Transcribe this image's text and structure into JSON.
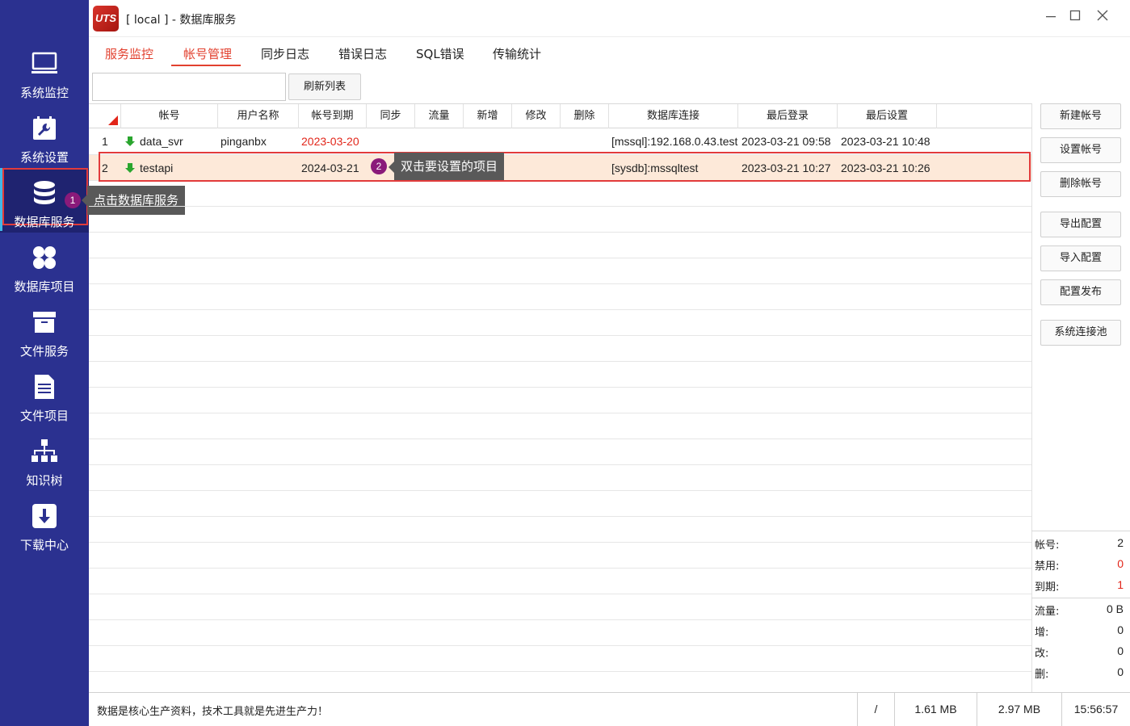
{
  "window": {
    "title": "[ local ] - 数据库服务",
    "logo_text": "UTS"
  },
  "sidebar": {
    "items": [
      {
        "label": "系统监控",
        "icon": "monitor-icon"
      },
      {
        "label": "系统设置",
        "icon": "settings-wrench-icon"
      },
      {
        "label": "数据库服务",
        "icon": "database-icon",
        "active": true
      },
      {
        "label": "数据库项目",
        "icon": "grid-dots-icon"
      },
      {
        "label": "文件服务",
        "icon": "archive-box-icon"
      },
      {
        "label": "文件项目",
        "icon": "document-list-icon"
      },
      {
        "label": "知识树",
        "icon": "org-tree-icon"
      },
      {
        "label": "下载中心",
        "icon": "download-icon"
      }
    ]
  },
  "callouts": {
    "step1": {
      "num": "1",
      "text": "点击数据库服务"
    },
    "step2": {
      "num": "2",
      "text": "双击要设置的项目"
    }
  },
  "tabs": [
    {
      "label": "服务监控"
    },
    {
      "label": "帐号管理",
      "active": true
    },
    {
      "label": "同步日志"
    },
    {
      "label": "错误日志"
    },
    {
      "label": "SQL错误"
    },
    {
      "label": "传输统计"
    }
  ],
  "toolbar": {
    "search_value": "",
    "refresh_label": "刷新列表"
  },
  "table": {
    "columns": [
      "帐号",
      "用户名称",
      "帐号到期",
      "同步",
      "流量",
      "新增",
      "修改",
      "删除",
      "数据库连接",
      "最后登录",
      "最后设置"
    ],
    "rows": [
      {
        "no": "1",
        "account": "data_svr",
        "username": "pinganbx",
        "expiry": "2023-03-20",
        "expired": true,
        "db": "[mssql]:192.168.0.43.test",
        "last_login": "2023-03-21 09:58",
        "last_set": "2023-03-21 10:48"
      },
      {
        "no": "2",
        "account": "testapi",
        "username": "",
        "expiry": "2024-03-21",
        "expired": false,
        "db": "[sysdb]:mssqltest",
        "last_login": "2023-03-21 10:27",
        "last_set": "2023-03-21 10:26"
      }
    ]
  },
  "actions": {
    "new_account": "新建帐号",
    "set_account": "设置帐号",
    "delete_account": "删除帐号",
    "export_config": "导出配置",
    "import_config": "导入配置",
    "publish_config": "配置发布",
    "conn_pool": "系统连接池"
  },
  "stats": {
    "account_label": "帐号:",
    "account": "2",
    "disabled_label": "禁用:",
    "disabled": "0",
    "expired_label": "到期:",
    "expired": "1",
    "traffic_label": "流量:",
    "traffic": "0 B",
    "add_label": "增:",
    "add": "0",
    "modify_label": "改:",
    "modify": "0",
    "delete_label": "删:",
    "delete": "0"
  },
  "statusbar": {
    "message": "数据是核心生产资料，技术工具就是先进生产力！",
    "slash": "/",
    "mem1": "1.61 MB",
    "mem2": "2.97 MB",
    "time": "15:56:57"
  },
  "colors": {
    "sidebar": "#2b3190",
    "accent": "#e2412f",
    "highlight_row": "#fde9d9",
    "expired_text": "#e2261a"
  }
}
